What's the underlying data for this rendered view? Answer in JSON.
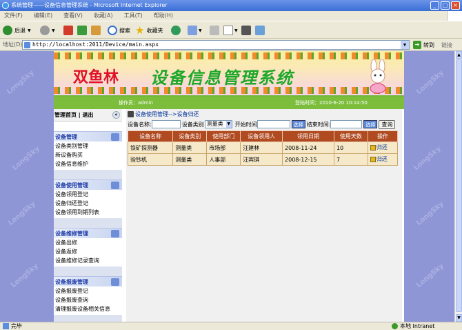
{
  "window": {
    "title": "系统管理——设备信息管理系统 - Microsoft Internet Explorer",
    "controls": {
      "minimize": "_",
      "maximize": "□",
      "close": "×"
    }
  },
  "menubar": [
    "文件(F)",
    "编辑(E)",
    "查看(V)",
    "收藏(A)",
    "工具(T)",
    "帮助(H)"
  ],
  "toolbar": {
    "back": "后退",
    "search": "搜索",
    "favorites": "收藏夹"
  },
  "address": {
    "label": "地址(D)",
    "url": "http://localhost:2011/Device/main.aspx",
    "go": "转到",
    "links": "链接"
  },
  "banner": {
    "title_red": "双鱼林",
    "title_green": "设备信息管理系统"
  },
  "background_watermark": "LongSky",
  "infobar": {
    "operator": "操作员：admin",
    "login_time": "登陆时间：2010-6-20 10:14:50"
  },
  "nav": {
    "header": "管理首页 | 退出",
    "collapse": "«",
    "sections": [
      {
        "title": "设备管理",
        "icon": "devices-icon",
        "items": [
          "设备类别管理",
          "新设备购买",
          "设备信息维护"
        ]
      },
      {
        "title": "设备使用管理",
        "icon": "usage-icon",
        "items": [
          "设备领用登记",
          "设备归还登记",
          "设备领用到期列表"
        ]
      },
      {
        "title": "设备维修管理",
        "icon": "repair-icon",
        "items": [
          "设备出修",
          "设备返修",
          "设备维修记录查询"
        ]
      },
      {
        "title": "设备报废管理",
        "icon": "scrap-icon",
        "items": [
          "设备报废登记",
          "设备报废查询",
          "清理报废设备相关信息"
        ]
      }
    ]
  },
  "content": {
    "breadcrumb": "设备使用管理-->设备归还",
    "search": {
      "name_label": "设备名称:",
      "name_value": "",
      "category_label": "设备类别",
      "category_value": "测量类",
      "start_label": "开始时间",
      "start_value": "",
      "pick_label": "选择",
      "end_label": "结束时间:",
      "end_value": "",
      "query": "查询"
    },
    "table": {
      "headers": [
        "设备名称",
        "设备类别",
        "使用部门",
        "设备领用人",
        "领用日期",
        "使用天数",
        "操作"
      ],
      "rows": [
        [
          "铁矿探测器",
          "测量类",
          "市场部",
          "汪建林",
          "2008-11-24",
          "10",
          "归还"
        ],
        [
          "验钞机",
          "测量类",
          "人事部",
          "汪宾琪",
          "2008-12-15",
          "7",
          "归还"
        ]
      ]
    }
  },
  "status": {
    "left": "完毕",
    "zone": "本地 Intranet"
  }
}
